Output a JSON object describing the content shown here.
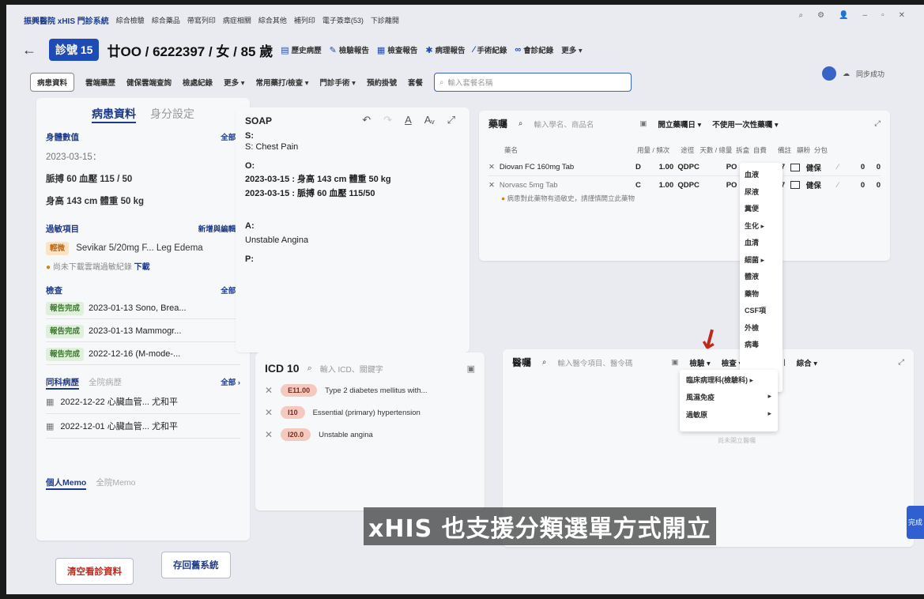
{
  "menubar": {
    "brand": "振興醫院 xHIS 門診系統",
    "items": [
      "綜合檢驗",
      "綜合藥品",
      "帶寫列印",
      "病症相關",
      "綜合其他",
      "補列印",
      "電子簽章(53)",
      "下診離開"
    ]
  },
  "patient": {
    "clinic_no": "診號 15",
    "name_line": "廿OO / 6222397 / 女 / 85 歲",
    "buttons": [
      "歷史病歷",
      "檢驗報告",
      "檢查報告",
      "病理報告",
      "手術紀錄",
      "會診紀錄",
      "更多 ▾"
    ]
  },
  "toolbar": {
    "items": [
      "病患資料",
      "雲端藥歷",
      "健保雲端查詢",
      "檢處紀錄",
      "更多 ▾",
      "常用藥打/檢查 ▾",
      "門診手術 ▾",
      "預約掛號",
      "套餐"
    ],
    "search_placeholder": "輸入套餐名稱"
  },
  "sync": {
    "label": "同步成功"
  },
  "left_panel": {
    "tab_active": "病患資料",
    "tab_inactive": "身分設定",
    "vitals_head": "身體數值",
    "all": "全部 ›",
    "vitals_date": "2023-03-15：",
    "vitals_row1": "脈搏  60    血壓  115  /  50",
    "vitals_row2": "身高  143  cm   體重  50   kg",
    "allergy_head": "過敏項目",
    "allergy_add": "新增與編輯 ›",
    "allergy_tag": "輕微",
    "allergy_text": "Sevikar 5/20mg F... Leg Edema",
    "allergy_note": "尚未下載雲端過敏紀錄",
    "allergy_download": "下載",
    "exam_head": "檢查",
    "exam_all": "全部 ›",
    "exams": [
      {
        "tag": "報告完成",
        "text": "2023-01-13   Sono, Brea..."
      },
      {
        "tag": "報告完成",
        "text": "2023-01-13   Mammogr..."
      },
      {
        "tag": "報告完成",
        "text": "2022-12-16   (M-mode-..."
      }
    ],
    "history_head": "同科病歷",
    "history_tab2": "全院病歷",
    "history_all": "全部 ›",
    "history": [
      {
        "text": "2022-12-22   心臟血管...   尤和平"
      },
      {
        "text": "2022-12-01   心臟血管...   尤和平"
      }
    ],
    "memo_active": "個人Memo",
    "memo_inactive": "全院Memo"
  },
  "soap": {
    "title": "SOAP",
    "s_label": "S:",
    "s_text": "S: Chest Pain",
    "o_label": "O:",
    "o_line1": "2023-03-15 : 身高 143 cm 體重 50 kg",
    "o_line2": "2023-03-15 : 脈搏 60 血壓 115/50",
    "a_label": "A:",
    "a_text": "Unstable Angina",
    "p_label": "P:"
  },
  "icd": {
    "title": "ICD 10",
    "search_placeholder": "輸入 ICD、關鍵字",
    "rows": [
      {
        "code": "E11.00",
        "desc": "Type 2 diabetes mellitus with..."
      },
      {
        "code": "I10",
        "desc": "Essential (primary) hypertension"
      },
      {
        "code": "I20.0",
        "desc": "Unstable angina"
      }
    ]
  },
  "rx": {
    "title": "藥囑",
    "search_placeholder": "輸入學名、商品名",
    "filter1": "開立藥囑日 ▾",
    "filter2": "不使用一次性藥囑 ▾",
    "header_name": "藥名",
    "header_cols": "用量 / 頻次      途徑   天數 / 總量  拆盒  自費      備註   顯粉  分包",
    "rows": [
      {
        "name": "Diovan FC 160mg Tab",
        "flag": "D",
        "dose": "1.00  QDPC",
        "route": "PO",
        "days": "7",
        "total": "7",
        "pay": "健保",
        "n1": "0",
        "n2": "0"
      },
      {
        "name": "Norvasc 5mg Tab",
        "flag": "C",
        "dose": "1.00  QDPC",
        "route": "PO",
        "days": "",
        "total": "7",
        "pay": "健保",
        "n1": "0",
        "n2": "0"
      }
    ],
    "warning": "病患對此藥物有過敏史，請謹慎開立此藥物"
  },
  "orders": {
    "title": "醫囑",
    "search_placeholder": "輸入醫令項目、醫令碼",
    "menu": [
      "檢驗 ▾",
      "檢查 ▾",
      "|",
      "綜合 ▾"
    ],
    "empty_hint": "尚未開立醫囑"
  },
  "dropdown": {
    "items": [
      "血液",
      "尿液",
      "糞便",
      "生化 ▸",
      "血清",
      "細菌 ▸",
      "體液",
      "藥物",
      "CSF項",
      "外檢",
      "病毒"
    ]
  },
  "submenu": {
    "items": [
      {
        "label": "臨床病理科(檢驗科) ▸"
      },
      {
        "label": "風濕免疫"
      },
      {
        "label": "過敏原"
      }
    ],
    "arrow": "▸"
  },
  "bottom": {
    "clear": "清空看診資料",
    "save": "存回舊系統"
  },
  "caption": "xHIS 也支援分類選單方式開立",
  "done_label": "完成"
}
